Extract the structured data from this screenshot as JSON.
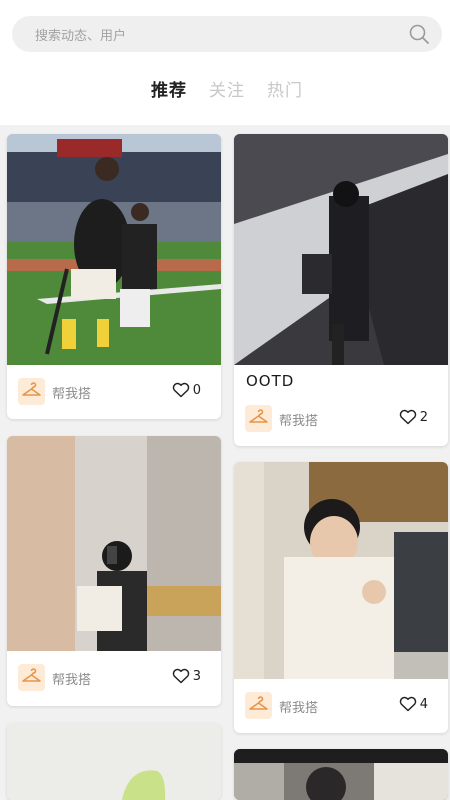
{
  "search": {
    "placeholder": "搜索动态、用户"
  },
  "tabs": [
    {
      "label": "推荐",
      "active": true
    },
    {
      "label": "关注",
      "active": false
    },
    {
      "label": "热门",
      "active": false
    }
  ],
  "cards": [
    {
      "caption": "",
      "help_label": "帮我搭",
      "likes": "0"
    },
    {
      "caption": "OOTD",
      "help_label": "帮我搭",
      "likes": "2"
    },
    {
      "caption": "",
      "help_label": "帮我搭",
      "likes": "3"
    },
    {
      "caption": "",
      "help_label": "帮我搭",
      "likes": "4"
    }
  ],
  "colors": {
    "accent": "#e8954a",
    "hanger_bg": "#fdebd7"
  }
}
